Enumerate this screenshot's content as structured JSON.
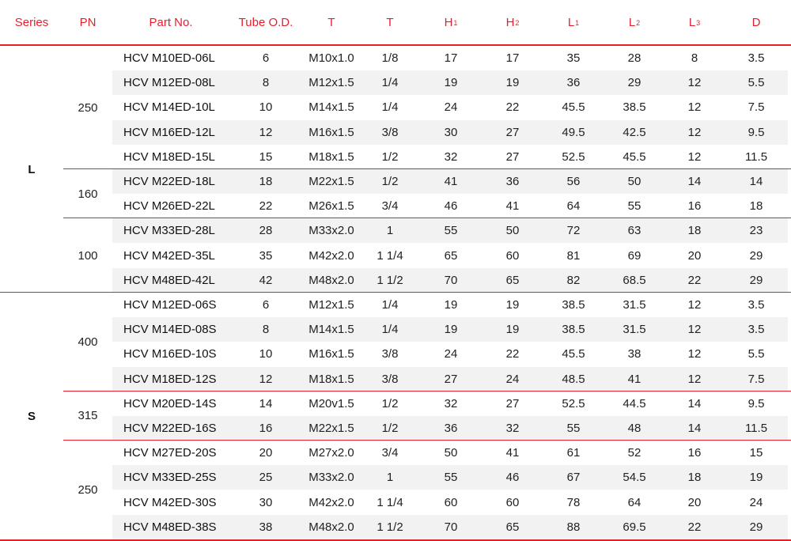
{
  "header": {
    "series": "Series",
    "pn": "PN",
    "part_no": "Part No.",
    "tube_od": "Tube O.D.",
    "t1": "T",
    "t2": "T",
    "h1": {
      "main": "H",
      "sub": "1"
    },
    "h2": {
      "main": "H",
      "sub": "2"
    },
    "l1": {
      "main": "L",
      "sub": "1"
    },
    "l2": {
      "main": "L",
      "sub": "2"
    },
    "l3": {
      "main": "L",
      "sub": "3"
    },
    "d": "D"
  },
  "series_groups": [
    {
      "label": "L",
      "pn_groups": [
        {
          "pn": "250",
          "rows": 5
        },
        {
          "pn": "160",
          "rows": 2
        },
        {
          "pn": "100",
          "rows": 3
        }
      ]
    },
    {
      "label": "S",
      "pn_groups": [
        {
          "pn": "400",
          "rows": 4
        },
        {
          "pn": "315",
          "rows": 2
        },
        {
          "pn": "250",
          "rows": 4
        }
      ]
    }
  ],
  "rows": [
    {
      "part": "HCV M10ED-06L",
      "tube": "6",
      "t": "M10x1.0",
      "t2": "1/8",
      "h1": "17",
      "h2": "17",
      "l1": "35",
      "l2": "28",
      "l3": "8",
      "d": "3.5"
    },
    {
      "part": "HCV M12ED-08L",
      "tube": "8",
      "t": "M12x1.5",
      "t2": "1/4",
      "h1": "19",
      "h2": "19",
      "l1": "36",
      "l2": "29",
      "l3": "12",
      "d": "5.5"
    },
    {
      "part": "HCV M14ED-10L",
      "tube": "10",
      "t": "M14x1.5",
      "t2": "1/4",
      "h1": "24",
      "h2": "22",
      "l1": "45.5",
      "l2": "38.5",
      "l3": "12",
      "d": "7.5"
    },
    {
      "part": "HCV M16ED-12L",
      "tube": "12",
      "t": "M16x1.5",
      "t2": "3/8",
      "h1": "30",
      "h2": "27",
      "l1": "49.5",
      "l2": "42.5",
      "l3": "12",
      "d": "9.5"
    },
    {
      "part": "HCV M18ED-15L",
      "tube": "15",
      "t": "M18x1.5",
      "t2": "1/2",
      "h1": "32",
      "h2": "27",
      "l1": "52.5",
      "l2": "45.5",
      "l3": "12",
      "d": "11.5"
    },
    {
      "part": "HCV M22ED-18L",
      "tube": "18",
      "t": "M22x1.5",
      "t2": "1/2",
      "h1": "41",
      "h2": "36",
      "l1": "56",
      "l2": "50",
      "l3": "14",
      "d": "14"
    },
    {
      "part": "HCV M26ED-22L",
      "tube": "22",
      "t": "M26x1.5",
      "t2": "3/4",
      "h1": "46",
      "h2": "41",
      "l1": "64",
      "l2": "55",
      "l3": "16",
      "d": "18"
    },
    {
      "part": "HCV M33ED-28L",
      "tube": "28",
      "t": "M33x2.0",
      "t2": "1",
      "h1": "55",
      "h2": "50",
      "l1": "72",
      "l2": "63",
      "l3": "18",
      "d": "23"
    },
    {
      "part": "HCV M42ED-35L",
      "tube": "35",
      "t": "M42x2.0",
      "t2": "1 1/4",
      "h1": "65",
      "h2": "60",
      "l1": "81",
      "l2": "69",
      "l3": "20",
      "d": "29"
    },
    {
      "part": "HCV M48ED-42L",
      "tube": "42",
      "t": "M48x2.0",
      "t2": "1 1/2",
      "h1": "70",
      "h2": "65",
      "l1": "82",
      "l2": "68.5",
      "l3": "22",
      "d": "29"
    },
    {
      "part": "HCV M12ED-06S",
      "tube": "6",
      "t": "M12x1.5",
      "t2": "1/4",
      "h1": "19",
      "h2": "19",
      "l1": "38.5",
      "l2": "31.5",
      "l3": "12",
      "d": "3.5"
    },
    {
      "part": "HCV M14ED-08S",
      "tube": "8",
      "t": "M14x1.5",
      "t2": "1/4",
      "h1": "19",
      "h2": "19",
      "l1": "38.5",
      "l2": "31.5",
      "l3": "12",
      "d": "3.5"
    },
    {
      "part": "HCV M16ED-10S",
      "tube": "10",
      "t": "M16x1.5",
      "t2": "3/8",
      "h1": "24",
      "h2": "22",
      "l1": "45.5",
      "l2": "38",
      "l3": "12",
      "d": "5.5"
    },
    {
      "part": "HCV M18ED-12S",
      "tube": "12",
      "t": "M18x1.5",
      "t2": "3/8",
      "h1": "27",
      "h2": "24",
      "l1": "48.5",
      "l2": "41",
      "l3": "12",
      "d": "7.5"
    },
    {
      "part": "HCV M20ED-14S",
      "tube": "14",
      "t": "M20v1.5",
      "t2": "1/2",
      "h1": "32",
      "h2": "27",
      "l1": "52.5",
      "l2": "44.5",
      "l3": "14",
      "d": "9.5"
    },
    {
      "part": "HCV M22ED-16S",
      "tube": "16",
      "t": "M22x1.5",
      "t2": "1/2",
      "h1": "36",
      "h2": "32",
      "l1": "55",
      "l2": "48",
      "l3": "14",
      "d": "11.5"
    },
    {
      "part": "HCV M27ED-20S",
      "tube": "20",
      "t": "M27x2.0",
      "t2": "3/4",
      "h1": "50",
      "h2": "41",
      "l1": "61",
      "l2": "52",
      "l3": "16",
      "d": "15"
    },
    {
      "part": "HCV M33ED-25S",
      "tube": "25",
      "t": "M33x2.0",
      "t2": "1",
      "h1": "55",
      "h2": "46",
      "l1": "67",
      "l2": "54.5",
      "l3": "18",
      "d": "19"
    },
    {
      "part": "HCV M42ED-30S",
      "tube": "30",
      "t": "M42x2.0",
      "t2": "1 1/4",
      "h1": "60",
      "h2": "60",
      "l1": "78",
      "l2": "64",
      "l3": "20",
      "d": "24"
    },
    {
      "part": "HCV M48ED-38S",
      "tube": "38",
      "t": "M48x2.0",
      "t2": "1 1/2",
      "h1": "70",
      "h2": "65",
      "l1": "88",
      "l2": "69.5",
      "l3": "22",
      "d": "29"
    }
  ]
}
